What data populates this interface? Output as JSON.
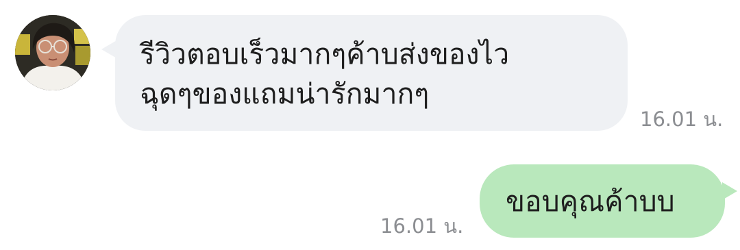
{
  "chat": {
    "messages": [
      {
        "direction": "incoming",
        "text": "รีวิวตอบเร็วมากๆค้าบส่งของไว\nฉุดๆของแถมน่ารักมากๆ",
        "time": "16.01 น.",
        "bubble_color": "#eff1f4",
        "avatar": "user-avatar"
      },
      {
        "direction": "outgoing",
        "text": "ขอบคุณค้าบบ",
        "time": "16.01 น.",
        "bubble_color": "#b9e8bc"
      }
    ]
  }
}
